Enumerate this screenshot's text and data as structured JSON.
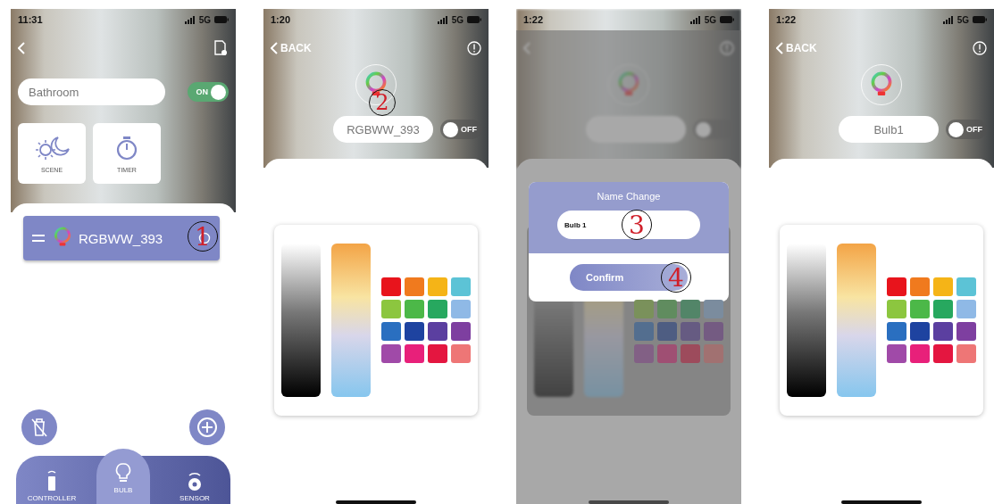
{
  "screens": [
    {
      "kind": "room",
      "time": "11:31",
      "network": "5G",
      "room_name": "Bathroom",
      "power": {
        "label": "ON",
        "on": true
      },
      "tiles": [
        {
          "kind": "scene",
          "label": "SCENE"
        },
        {
          "kind": "timer",
          "label": "TIMER"
        }
      ],
      "devices": [
        {
          "name": "RGBWW_393",
          "callout": "1"
        }
      ],
      "nav": [
        {
          "kind": "controller",
          "label": "CONTROLLER",
          "selected": false
        },
        {
          "kind": "bulb",
          "label": "BULB",
          "selected": true
        },
        {
          "kind": "sensor",
          "label": "SENSOR",
          "selected": false
        }
      ]
    },
    {
      "kind": "bulb",
      "time": "1:20",
      "network": "5G",
      "back": "BACK",
      "bulb_name": "RGBWW_393",
      "name_callout": "2",
      "power": {
        "label": "OFF",
        "on": false
      },
      "swatches": [
        {
          "color": "#e8141c"
        },
        {
          "color": "#f07a1e"
        },
        {
          "color": "#f5b417"
        },
        {
          "color": "#5cc3d6"
        },
        {
          "color": "#8cc63f"
        },
        {
          "color": "#4cb848"
        },
        {
          "color": "#27a85f"
        },
        {
          "color": "#8fb9e6"
        },
        {
          "color": "#2a6fc0"
        },
        {
          "color": "#1e43a0"
        },
        {
          "color": "#5b3fa0"
        },
        {
          "color": "#7e3fa0"
        },
        {
          "color": "#a04aa8"
        },
        {
          "color": "#e8207a"
        },
        {
          "color": "#e41640"
        },
        {
          "color": "#ee7676"
        }
      ]
    },
    {
      "kind": "dialog",
      "time": "1:22",
      "network": "5G",
      "power": {
        "on": false
      },
      "swatches": [
        {
          "color": "#7a915b"
        },
        {
          "color": "#608c5f"
        },
        {
          "color": "#528568"
        },
        {
          "color": "#7b8c9e"
        },
        {
          "color": "#536e8f"
        },
        {
          "color": "#4e5d82"
        },
        {
          "color": "#665b82"
        },
        {
          "color": "#745b82"
        },
        {
          "color": "#826085"
        },
        {
          "color": "#9f4f73"
        },
        {
          "color": "#9d4b5c"
        },
        {
          "color": "#a17171"
        }
      ],
      "dialog": {
        "title": "Name Change",
        "value": "Bulb 1",
        "input_callout": "3",
        "button": "Confirm",
        "button_callout": "4"
      }
    },
    {
      "kind": "bulb",
      "time": "1:22",
      "network": "5G",
      "back": "BACK",
      "bulb_name": "Bulb1",
      "power": {
        "label": "OFF",
        "on": false
      },
      "swatches": [
        {
          "color": "#e8141c"
        },
        {
          "color": "#f07a1e"
        },
        {
          "color": "#f5b417"
        },
        {
          "color": "#5cc3d6"
        },
        {
          "color": "#8cc63f"
        },
        {
          "color": "#4cb848"
        },
        {
          "color": "#27a85f"
        },
        {
          "color": "#8fb9e6"
        },
        {
          "color": "#2a6fc0"
        },
        {
          "color": "#1e43a0"
        },
        {
          "color": "#5b3fa0"
        },
        {
          "color": "#7e3fa0"
        },
        {
          "color": "#a04aa8"
        },
        {
          "color": "#e8207a"
        },
        {
          "color": "#e41640"
        },
        {
          "color": "#ee7676"
        }
      ]
    }
  ]
}
